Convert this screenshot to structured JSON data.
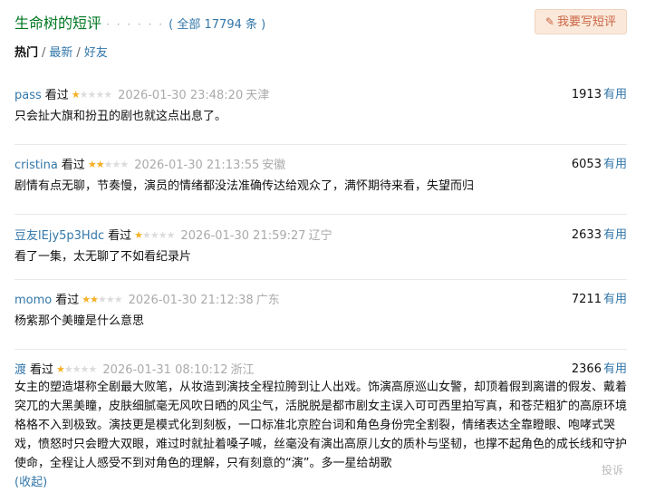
{
  "header": {
    "title": "生命树的短评",
    "dots": "· · · · · ·",
    "count_text": "( 全部 17794 条 )",
    "write_button": "我要写短评",
    "write_icon": "pencil-icon"
  },
  "tabs": [
    {
      "label": "热门",
      "active": true
    },
    {
      "label": "最新",
      "active": false
    },
    {
      "label": "好友",
      "active": false
    }
  ],
  "tab_separator": "/",
  "watched_label": "看过",
  "useful_label": "有用",
  "star_color": "#f6b026",
  "comments": [
    {
      "user": "pass",
      "rating": 1,
      "time": "2026-01-30 23:48:20",
      "location": "天津",
      "votes": "1913",
      "text": "只会扯大旗和扮丑的剧也就这点出息了。"
    },
    {
      "user": "cristina",
      "rating": 2,
      "time": "2026-01-30 21:13:55",
      "location": "安徽",
      "votes": "6053",
      "text": "剧情有点无聊，节奏慢，演员的情绪都没法准确传达给观众了，满怀期待来看，失望而归"
    },
    {
      "user": "豆友lEjy5p3Hdc",
      "rating": 1,
      "time": "2026-01-30 21:59:27",
      "location": "辽宁",
      "votes": "2633",
      "text": "看了一集，太无聊了不如看纪录片"
    },
    {
      "user": "momo",
      "rating": 2,
      "time": "2026-01-30 21:12:38",
      "location": "广东",
      "votes": "7211",
      "text": "杨紫那个美瞳是什么意思"
    },
    {
      "user": "渡",
      "rating": 1,
      "time": "2026-01-31 08:10:12",
      "location": "浙江",
      "votes": "2366",
      "text": "女主的塑造堪称全剧最大败笔，从妆造到演技全程拉胯到让人出戏。饰演高原巡山女警，却顶着假到离谱的假发、戴着突兀的大黑美瞳，皮肤细腻毫无风吹日晒的风尘气，活脱脱是都市剧女主误入可可西里拍写真，和苍茫粗犷的高原环境格格不入到极致。演技更是模式化到刻板，一口标准北京腔台词和角色身份完全割裂，情绪表达全靠瞪眼、咆哮式哭戏，愤怒时只会瞪大双眼，难过时就扯着嗓子喊，丝毫没有演出高原儿女的质朴与坚韧，也撑不起角色的成长线和守护使命，全程让人感受不到对角色的理解，只有刻意的“演”。多一星给胡歌",
      "collapse": "(收起)"
    }
  ],
  "footer": {
    "report": "投诉"
  }
}
